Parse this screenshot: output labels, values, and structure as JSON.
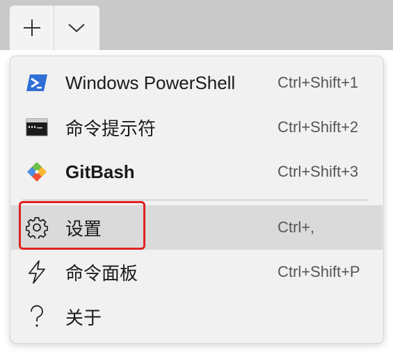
{
  "titlebar": {
    "new_tab_icon": "plus-icon",
    "dropdown_icon": "chevron-down-icon"
  },
  "menu": {
    "items": [
      {
        "label": "Windows PowerShell",
        "shortcut": "Ctrl+Shift+1",
        "icon": "powershell-icon",
        "bold": false
      },
      {
        "label": "命令提示符",
        "shortcut": "Ctrl+Shift+2",
        "icon": "command-prompt-icon",
        "bold": false
      },
      {
        "label": "GitBash",
        "shortcut": "Ctrl+Shift+3",
        "icon": "git-icon",
        "bold": true
      },
      {
        "label": "设置",
        "shortcut": "Ctrl+,",
        "icon": "gear-icon",
        "bold": false,
        "hovered": true
      },
      {
        "label": "命令面板",
        "shortcut": "Ctrl+Shift+P",
        "icon": "lightning-icon",
        "bold": false
      },
      {
        "label": "关于",
        "shortcut": "",
        "icon": "question-mark-icon",
        "bold": false
      }
    ]
  },
  "colors": {
    "titlebar_bg": "#c9c9c9",
    "menu_bg": "#f1f1f1",
    "hover_bg": "#dadada",
    "highlight_annotation": "#e02020",
    "powershell_blue": "#2f6fd6",
    "git_orange": "#f05133"
  }
}
